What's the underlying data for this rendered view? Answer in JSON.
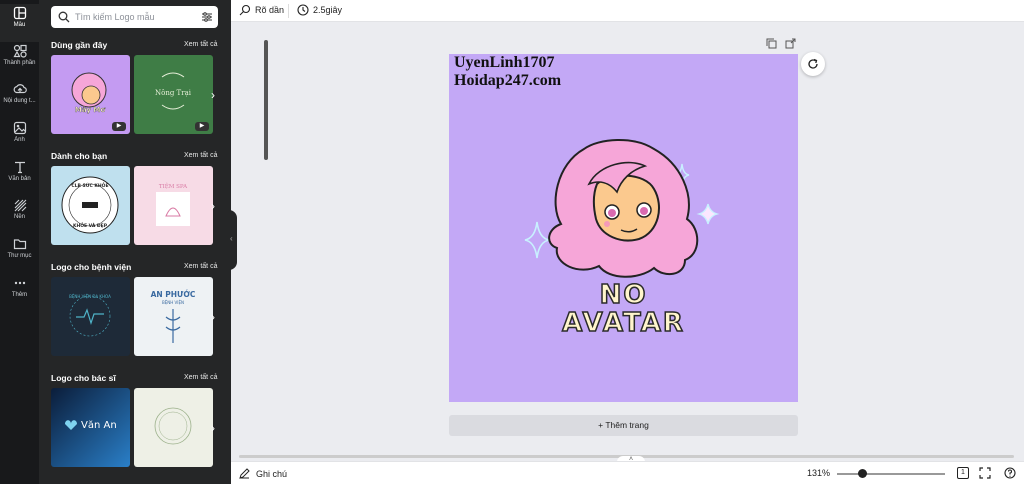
{
  "rail": [
    {
      "label": "Mẫu",
      "icon": "template-icon"
    },
    {
      "label": "Thành phần",
      "icon": "elements-icon"
    },
    {
      "label": "Nội dung t...",
      "icon": "upload-icon"
    },
    {
      "label": "Ảnh",
      "icon": "photo-icon"
    },
    {
      "label": "Văn bản",
      "icon": "text-icon"
    },
    {
      "label": "Nền",
      "icon": "background-icon"
    },
    {
      "label": "Thư mục",
      "icon": "folder-icon"
    },
    {
      "label": "Thêm",
      "icon": "more-icon"
    }
  ],
  "search": {
    "placeholder": "Tìm kiếm Logo mẫu"
  },
  "sections": [
    {
      "title": "Dùng gần đây",
      "link": "Xem tất cả"
    },
    {
      "title": "Dành cho bạn",
      "link": "Xem tất cả"
    },
    {
      "title": "Logo cho bệnh viện",
      "link": "Xem tất cả"
    },
    {
      "title": "Logo cho bác sĩ",
      "link": "Xem tất cả"
    }
  ],
  "thumbs": {
    "recent1": "Mây Mơ",
    "recent2": "Nông Trại",
    "fy1_top": "CLB SỨC KHỎE",
    "fy1_bottom": "KHỎE VÀ ĐẸP",
    "fy2": "TIỆM SPA",
    "hosp1": "BỆNH VIỆN ĐA KHOA",
    "hosp2_title": "AN PHƯỚC",
    "hosp2_sub": "BỆNH VIỆN",
    "doc1": "Văn An"
  },
  "topbar": {
    "undo_label": "Rõ dần",
    "timer_label": "2.5giây"
  },
  "canvas": {
    "watermark1": "UyenLinh1707",
    "watermark2": "Hoidap247.com",
    "logo_line1": "NO",
    "logo_line2": "AVATAR",
    "add_page": "+ Thêm trang"
  },
  "bottombar": {
    "notes_label": "Ghi chú",
    "zoom": "131%",
    "page_count": "1"
  },
  "colors": {
    "canvas_bg": "#c3a8f6",
    "panel_bg": "#252627",
    "rail_bg": "#18191b",
    "hair": "#f6a6d8"
  }
}
